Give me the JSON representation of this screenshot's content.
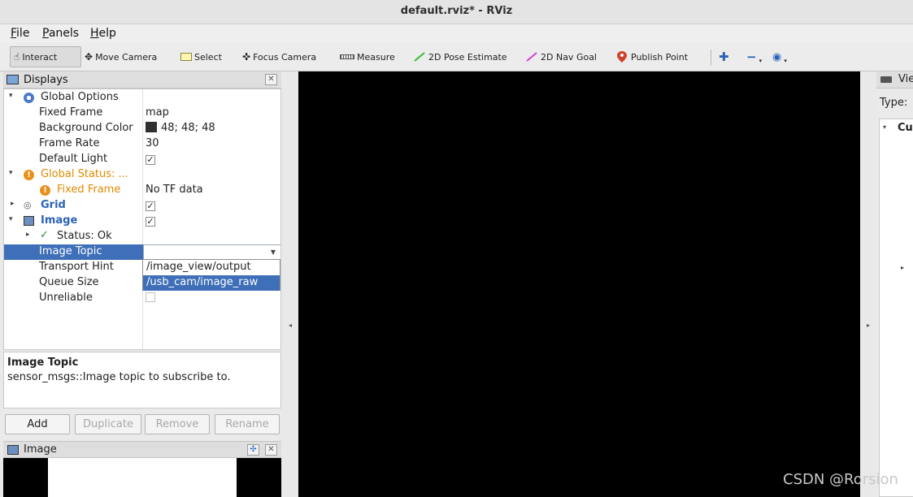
{
  "window": {
    "title": "default.rviz* - RViz"
  },
  "menu": [
    {
      "mnemonic": "F",
      "rest": "ile"
    },
    {
      "mnemonic": "P",
      "rest": "anels"
    },
    {
      "mnemonic": "H",
      "rest": "elp"
    }
  ],
  "toolbar": {
    "interact": "Interact",
    "move_camera": "Move Camera",
    "select": "Select",
    "focus_camera": "Focus Camera",
    "measure": "Measure",
    "pose_estimate": "2D Pose Estimate",
    "nav_goal": "2D Nav Goal",
    "publish_point": "Publish Point",
    "colors": {
      "pose_estimate": "#2fbf2f",
      "nav_goal": "#d63fd6",
      "publish_point": "#d2412b"
    }
  },
  "displays_panel": {
    "title": "Displays",
    "global_options": "Global Options",
    "fixed_frame": {
      "label": "Fixed Frame",
      "value": "map"
    },
    "background_color": {
      "label": "Background Color",
      "value": "48; 48; 48",
      "swatch": "#303030"
    },
    "frame_rate": {
      "label": "Frame Rate",
      "value": "30"
    },
    "default_light": {
      "label": "Default Light",
      "checked": true
    },
    "global_status": "Global Status: ...",
    "status_fixed_frame": {
      "label": "Fixed Frame",
      "value": "No TF data"
    },
    "grid": {
      "label": "Grid",
      "checked": true
    },
    "image": {
      "label": "Image",
      "checked": true
    },
    "status_ok": "Status: Ok",
    "image_topic": {
      "label": "Image Topic",
      "value": ""
    },
    "transport_hint": "Transport Hint",
    "queue_size": "Queue Size",
    "unreliable": {
      "label": "Unreliable",
      "checked": false
    },
    "topic_options": [
      "/image_view/output",
      "/usb_cam/image_raw"
    ],
    "highlighted_option": "/usb_cam/image_raw"
  },
  "description": {
    "title": "Image Topic",
    "text": "sensor_msgs::Image topic to subscribe to."
  },
  "buttons": {
    "add": "Add",
    "duplicate": "Duplicate",
    "remove": "Remove",
    "rename": "Rename"
  },
  "image_panel": {
    "title": "Image"
  },
  "views_panel": {
    "title": "Vie",
    "type_label": "Type:",
    "current": "Cur"
  },
  "watermark": "CSDN @Rorsion"
}
